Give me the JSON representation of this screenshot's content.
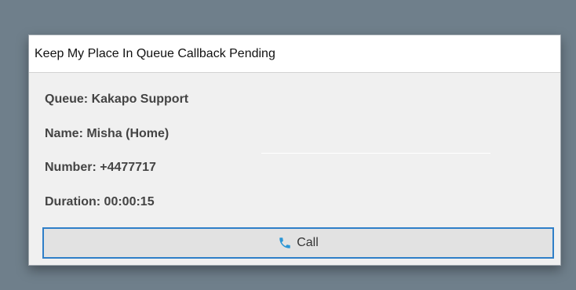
{
  "window": {
    "title": "Keep My Place In Queue Callback Pending"
  },
  "details": {
    "queue": "Queue: Kakapo Support",
    "name": "Name: Misha (Home)",
    "number": "Number: +4477717",
    "duration": "Duration: 00:00:15"
  },
  "actions": {
    "call_label": "Call",
    "call_icon": "phone-icon"
  },
  "colors": {
    "accent": "#2f7fc8",
    "phone_icon": "#2b96d6",
    "backdrop": "#6f7f8b"
  }
}
